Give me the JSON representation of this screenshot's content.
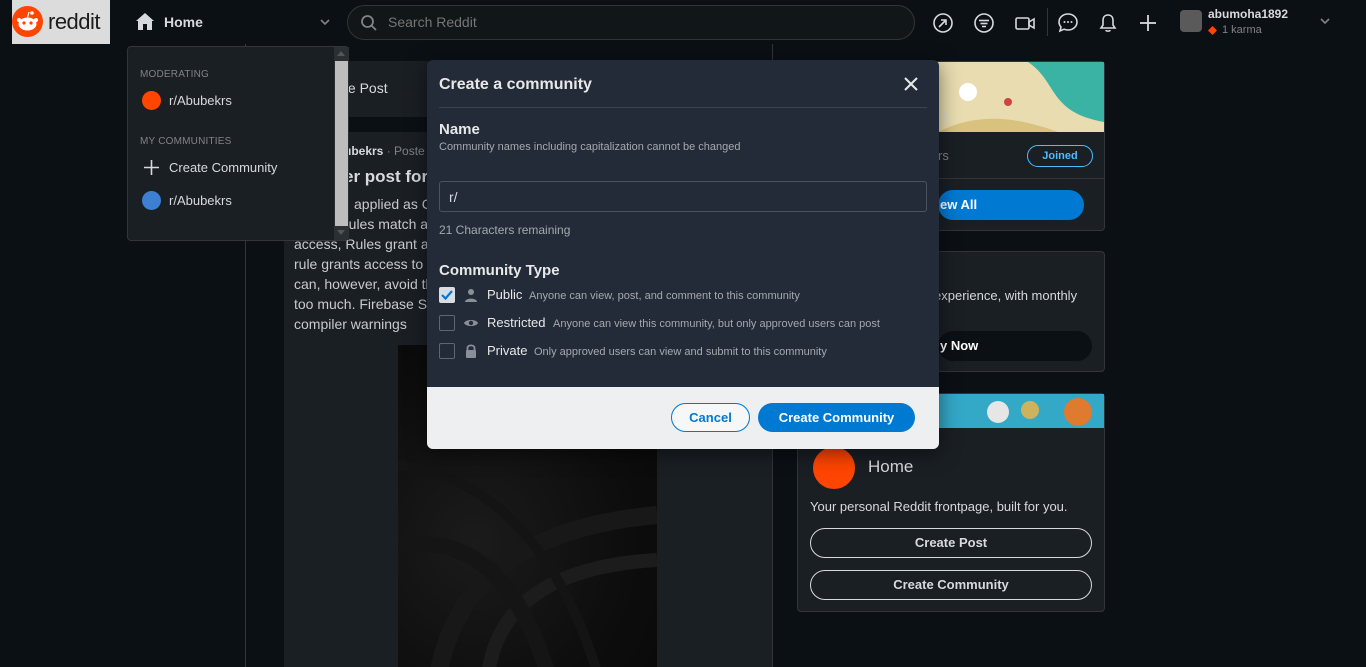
{
  "header": {
    "logo_text": "reddit",
    "home_label": "Home",
    "search_placeholder": "Search Reddit",
    "username": "abumoha1892",
    "karma": "1 karma"
  },
  "dropdown": {
    "moderating_heading": "MODERATING",
    "moderating_items": [
      "r/Abubekrs"
    ],
    "my_communities_heading": "MY COMMUNITIES",
    "create_community_label": "Create Community",
    "my_communities_items": [
      "r/Abubekrs"
    ]
  },
  "background": {
    "create_post_placeholder": "te Post",
    "post_author": "ubekrs",
    "post_meta": "· Poste",
    "post_title": "er post for",
    "post_body_lines": [
      "applied as C",
      "rules match a",
      "access, Rules grant ac",
      "rule grants access to c",
      "can, however, avoid th",
      "too much. Firebase Se",
      "compiler warnings"
    ],
    "sidebar_partial_rs": "rs",
    "sidebar_partial_members": "rs",
    "joined_label": "Joined",
    "view_all_label": "ew All",
    "premium_text": "experience, with monthly",
    "try_now_label": "y Now",
    "home_card_title": "Home",
    "home_card_desc": "Your personal Reddit frontpage, built for you.",
    "create_post_label": "Create Post",
    "create_community_label": "Create Community"
  },
  "modal": {
    "title": "Create a community",
    "name_label": "Name",
    "name_hint": "Community names including capitalization cannot be changed",
    "name_prefix": "r/",
    "name_value": "",
    "chars_remaining": "21 Characters remaining",
    "type_heading": "Community Type",
    "types": [
      {
        "name": "Public",
        "desc": "Anyone can view, post, and comment to this community",
        "checked": true,
        "icon": "user-icon"
      },
      {
        "name": "Restricted",
        "desc": "Anyone can view this community, but only approved users can post",
        "checked": false,
        "icon": "eye-icon"
      },
      {
        "name": "Private",
        "desc": "Only approved users can view and submit to this community",
        "checked": false,
        "icon": "lock-icon"
      }
    ],
    "cancel_label": "Cancel",
    "create_label": "Create Community"
  },
  "colors": {
    "accent": "#0079d3",
    "brand": "#ff4500",
    "background": "#0b1015",
    "modal_bg": "#232b38"
  }
}
